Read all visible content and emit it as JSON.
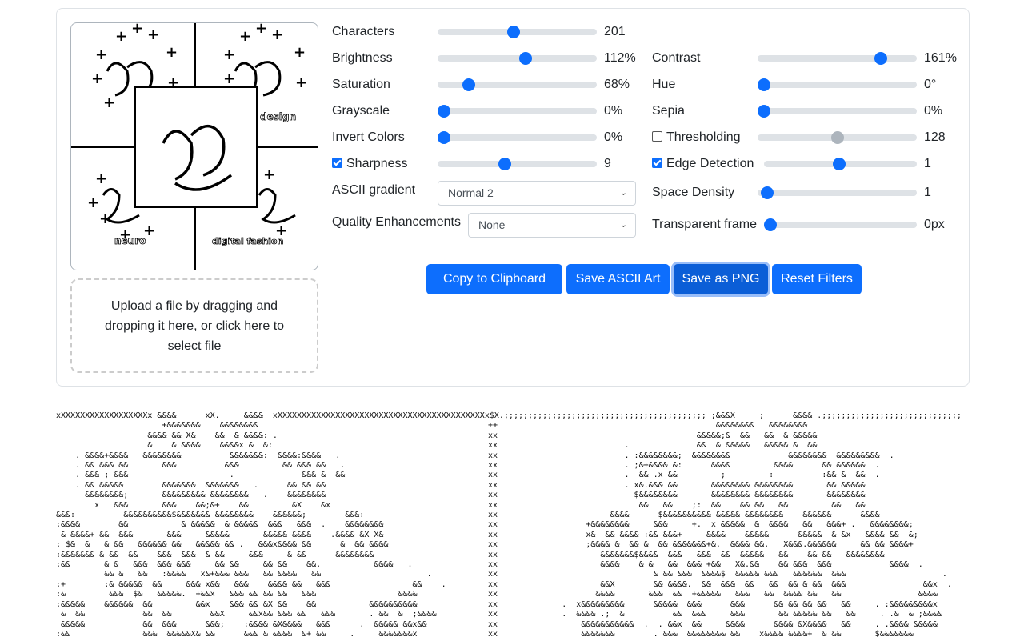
{
  "image_preview": {
    "labels": [
      "design",
      "neuro",
      "digital fashion"
    ]
  },
  "upload": {
    "text": "Upload a file by dragging and dropping it here, or click here to select file"
  },
  "controls": {
    "left": [
      {
        "id": "characters",
        "label": "Characters",
        "value": "201",
        "level": 0.475
      },
      {
        "id": "brightness",
        "label": "Brightness",
        "value": "112%",
        "level": 0.56
      },
      {
        "id": "saturation",
        "label": "Saturation",
        "value": "68%",
        "level": 0.17
      },
      {
        "id": "grayscale",
        "label": "Grayscale",
        "value": "0%",
        "level": 0
      },
      {
        "id": "invert-colors",
        "label": "Invert Colors",
        "value": "0%",
        "level": 0
      },
      {
        "id": "sharpness",
        "label": "Sharpness",
        "value": "9",
        "level": 0.415,
        "checked": true
      }
    ],
    "right": [
      {
        "id": "contrast",
        "label": "Contrast",
        "value": "161%",
        "level": 0.8
      },
      {
        "id": "hue",
        "label": "Hue",
        "value": "0°",
        "level": 0
      },
      {
        "id": "sepia",
        "label": "Sepia",
        "value": "0%",
        "level": 0
      },
      {
        "id": "thresholding",
        "label": "Thresholding",
        "value": "128",
        "level": 0.5,
        "checked": false,
        "disabled": true
      },
      {
        "id": "edge-detection",
        "label": "Edge Detection",
        "value": "1",
        "level": 0.49,
        "checked": true
      },
      {
        "id": "space-density",
        "label": "Space Density",
        "value": "1",
        "level": 0.02
      },
      {
        "id": "transparent-frame",
        "label": "Transparent frame",
        "value": "0px",
        "level": 0
      }
    ],
    "ascii_gradient": {
      "label": "ASCII gradient",
      "selected": "Normal 2"
    },
    "quality": {
      "label": "Quality Enhancements",
      "selected": "None"
    }
  },
  "buttons": {
    "copy": "Copy to Clipboard",
    "save_ascii": "Save ASCII Art",
    "save_png": "Save as PNG",
    "reset": "Reset Filters"
  },
  "ascii_art": {
    "top_line": "xXXXXXXXXXXXXXXXXXXx &&&&      xX.     &&&&  xXXXXXXXXXXXXXXXXXXXXXXXXXXXXXXXXXXXXXXXXXXXx$X.;;;;;;;;;;;;;;;;;;;;;;;;;;;;;;;;;;;;;;;;;; ;&&&X     ;      &&&& .;;;;;;;;;;;;;;;;;;;;;;;;;;;;;",
    "left_lines": [
      "                      +&&&&&&&    &&&&&&&&",
      "                   &&&& && X&    &&  & &&&&: .",
      "                   &    & &&&&    &&&&x &  &:",
      "    . &&&&+&&&&   &&&&&&&&          &&&&&&&:  &&&&:&&&&   .",
      "    . && &&& &&       &&&          &&&         && &&& &&   .",
      "    . &&& ; &&&                     .              &&& &  &&",
      "    . && &&&&&        &&&&&&&  &&&&&&&   .      && && &&",
      "      &&&&&&&&;       &&&&&&&&& &&&&&&&&   .    &&&&&&&&",
      "        x   &&&       &&&    &&;&+    &&         &X    &x",
      "&&&:          &&&&&&&&&&$&&&&&&& &&&&&&&&    &&&&&&;        &&&:",
      ":&&&&        &&           & &&&&&  & &&&&&  &&&   &&&  .    &&&&&&&&",
      " & &&&&+ &&  &&&       &&&     &&&&&       &&&&& &&&&    .&&&& &X X&",
      "; $&  &   & &&   &&&&&& &&   &&&&& && .   &&&x&&&& &&      &  && &&&&",
      ":&&&&&&& & &&  &&    &&&  &&&  & &&     &&&     & &&      &&&&&&&&",
      ":&&       & &   &&&  &&& &&&     && &&     && &&    &&.           &&&&   .",
      "          && &   &&   :&&&&   x&+&&& &&&   && &&&&   &&                      .",
      ":+        :& &&&&&  &&     &&& x&&   &&&    &&&& &&   &&&                 &&    .",
      ":&         &&&  $&   &&&&&.  +&&x   &&& && && &&   &&&                 &&&&",
      ":&&&&&    &&&&&&  &&         &&x    &&& && &X &&    &&           &&&&&&&&&&",
      " &  &&            &&  &&        &&X     &&x&& &&& &&   &&&       . &&  &  ;&&&&",
      " &&&&&            &&  &&&      &&&;    :&&&& &X&&&&   &&&      .  &&&&& &&x&&",
      ":&&               &&&  &&&&&X& &&      &&& & &&&&  &+ &&     .     &&&&&&&x"
    ],
    "divider_lines": [
      "++",
      "xx",
      "xx",
      "xx",
      "xx",
      "xx",
      "xx",
      "xx",
      "xx",
      "xx",
      "xx",
      "xx",
      "xx",
      "xx",
      "xx",
      "xx",
      "xx",
      "xx",
      "xx",
      "xx",
      "xx",
      "xx"
    ],
    "right_lines": [
      "                                            &&&&&&&&   &&&&&&&&",
      "                                        &&&&&;&  &&   &&  & &&&&&",
      "                         .              &&  & &&&&&   &&&&& &  &&",
      "                         . :&&&&&&&&;  &&&&&&&&            &&&&&&&&  &&&&&&&&&  .",
      "                         . ;&+&&&& &:      &&&&         &&&&      && &&&&&&  .",
      "                         .  && .x &&         ;         :          :&& &  &&  .",
      "                         . x&.&&& &&       &&&&&&&& &&&&&&&&       && &&&&&",
      "                           $&&&&&&&&       &&&&&&&& &&&&&&&&       &&&&&&&&",
      "                            &&   &&    ;:  &&    && &&   &&         &&   &&",
      "                      &&&&      $&&&&&&&&&& &&&&& &&&&&&&&    &&&&&&      &&&&",
      "                 +&&&&&&&&     &&&     +.  x &&&&&  &  &&&&   &&   &&&+ .   &&&&&&&&;",
      "                 x&  && &&&& :&& &&&+     &&&&    &&&&&      &&&&&  & &x   &&&& &&  &;",
      "                 ;&&&& &  && &  && &&&&&&&+&.  &&&& &&.   X&&&.&&&&&&     && && &&&&+",
      "                    &&&&&&&$&&&&  &&&   &&&  &&  &&&&&   &&    && &&   &&&&&&&&",
      "                    &&&&    & &   &&  &&& +&&   X&.&&    && &&&  &&&            &&&&  .",
      "                               & && &&&  &&&&$  &&&&& &&&   &&&&&&  &&&                    .",
      "                    &&X        && &&&&.  &&  &&&  &&   &&  && & &&  &&&                &&x  .",
      "                   &&&&       &&&  &&  +&&&&&   &&&   &&  &&&& &&   &&                &&&&",
      "            .  x&&&&&&&&&      &&&&&  &&&      &&&      && && && &&   &&     . :&&&&&&&&&x",
      "            .  &&&& .;  &          &&  &&&     &&&       && &&&&& &&   &&     . .&  & ;&&&&",
      "                &&&&&&&&&&&  .  . &&x  &&     &&&&      &&&& &X&&&&   &&     . .&&&& &&&&&",
      "                &&&&&&&        . &&&  &&&&&&&& &&    x&&&& &&&&+  & &&       $&&&&&&&"
    ]
  },
  "colors": {
    "primary": "#0d6efd",
    "primary_active": "#0b5ed7",
    "track": "#dee2e6",
    "disabled_thumb": "#adb5bd"
  }
}
